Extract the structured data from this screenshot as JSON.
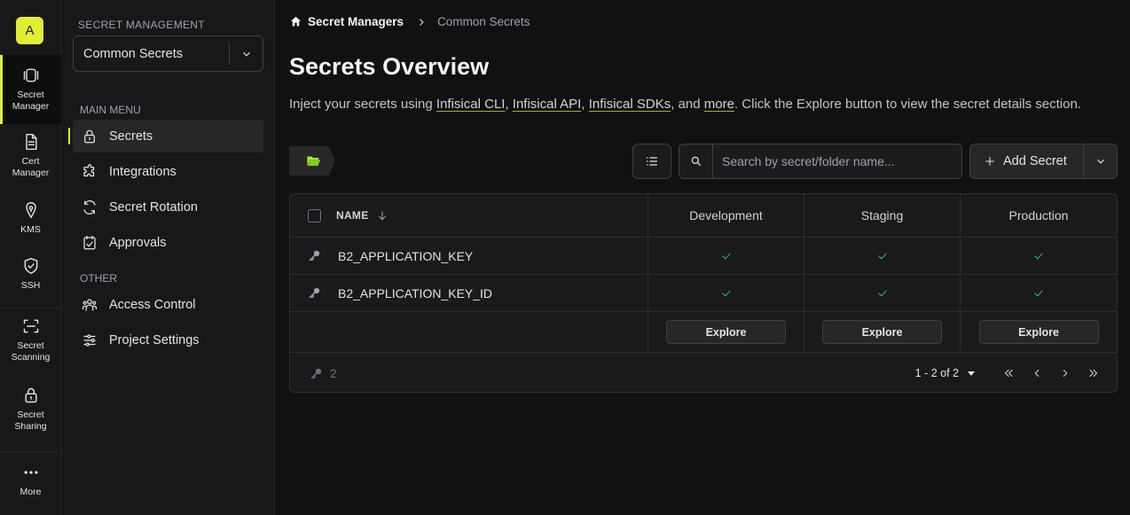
{
  "rail": {
    "avatar": "A",
    "items": [
      {
        "label_1": "Secret",
        "label_2": "Manager",
        "icon": "secret-manager-icon"
      },
      {
        "label_1": "Cert",
        "label_2": "Manager",
        "icon": "cert-manager-icon"
      },
      {
        "label_1": "KMS",
        "icon": "kms-icon"
      },
      {
        "label_1": "SSH",
        "icon": "ssh-shield-icon"
      },
      {
        "label_1": "Secret",
        "label_2": "Scanning",
        "icon": "scan-icon"
      },
      {
        "label_1": "Secret",
        "label_2": "Sharing",
        "icon": "lock-icon"
      },
      {
        "label_1": "More",
        "icon": "more-dots-icon"
      }
    ]
  },
  "sidebar": {
    "section_title": "SECRET MANAGEMENT",
    "project_select": "Common Secrets",
    "main_menu_label": "MAIN MENU",
    "main_items": [
      {
        "label": "Secrets",
        "icon": "lock-icon"
      },
      {
        "label": "Integrations",
        "icon": "puzzle-icon"
      },
      {
        "label": "Secret Rotation",
        "icon": "rotate-icon"
      },
      {
        "label": "Approvals",
        "icon": "checklist-icon"
      }
    ],
    "other_label": "OTHER",
    "other_items": [
      {
        "label": "Access Control",
        "icon": "users-icon"
      },
      {
        "label": "Project Settings",
        "icon": "sliders-icon"
      }
    ]
  },
  "breadcrumb": {
    "root": "Secret Managers",
    "current": "Common Secrets"
  },
  "page": {
    "title": "Secrets Overview",
    "desc_prefix": "Inject your secrets using ",
    "link_cli": "Infisical CLI",
    "sep1": ", ",
    "link_api": "Infisical API",
    "sep2": ", ",
    "link_sdks": "Infisical SDKs",
    "sep3": ", and ",
    "link_more": "more",
    "desc_suffix": ". Click the Explore button to view the secret details section."
  },
  "toolbar": {
    "search_placeholder": "Search by secret/folder name...",
    "add_label": "Add Secret"
  },
  "table": {
    "name_header": "NAME",
    "environments": [
      "Development",
      "Staging",
      "Production"
    ],
    "rows": [
      {
        "name": "B2_APPLICATION_KEY"
      },
      {
        "name": "B2_APPLICATION_KEY_ID"
      }
    ],
    "explore_label": "Explore",
    "count": "2",
    "pagination": "1 - 2 of 2"
  },
  "colors": {
    "accent": "#e0ed34",
    "check": "#22c55e",
    "background": "#111113"
  }
}
